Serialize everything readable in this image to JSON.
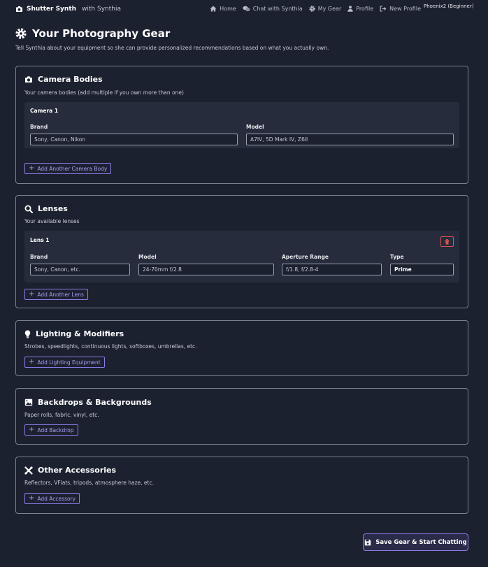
{
  "nav": {
    "brand": "Shutter Synth",
    "brand_sub": "with Synthia",
    "items": [
      {
        "label": "Home",
        "icon": "home-icon"
      },
      {
        "label": "Chat with Synthia",
        "icon": "chat-icon"
      },
      {
        "label": "My Gear",
        "icon": "gear-icon"
      },
      {
        "label": "Profile",
        "icon": "user-icon"
      },
      {
        "label": "New Profile",
        "icon": "sign-out-icon"
      }
    ],
    "user": "Phoenix2 (Beginner)"
  },
  "page": {
    "title": "Your Photography Gear",
    "description": "Tell Synthia about your equipment so she can provide personalized recommendations based on what you actually own."
  },
  "cameras": {
    "title": "Camera Bodies",
    "description": "Your camera bodies (add multiple if you own more than one)",
    "card_title": "Camera 1",
    "brand_label": "Brand",
    "brand_placeholder": "Sony, Canon, Nikon",
    "model_label": "Model",
    "model_placeholder": "A7IV, 5D Mark IV, Z6II",
    "add_label": "Add Another Camera Body"
  },
  "lenses": {
    "title": "Lenses",
    "description": "Your available lenses",
    "card_title": "Lens 1",
    "brand_label": "Brand",
    "brand_placeholder": "Sony, Canon, etc.",
    "model_label": "Model",
    "model_placeholder": "24-70mm f/2.8",
    "aperture_label": "Aperture Range",
    "aperture_placeholder": "f/1.8, f/2.8-4",
    "type_label": "Type",
    "type_value": "Prime",
    "add_label": "Add Another Lens"
  },
  "lighting": {
    "title": "Lighting & Modifiers",
    "description": "Strobes, speedlights, continuous lights, softboxes, umbrellas, etc.",
    "add_label": "Add Lighting Equipment"
  },
  "backdrops": {
    "title": "Backdrops & Backgrounds",
    "description": "Paper rolls, fabric, vinyl, etc.",
    "add_label": "Add Backdrop"
  },
  "accessories": {
    "title": "Other Accessories",
    "description": "Reflectors, VFlats, tripods, atmosphere haze, etc.",
    "add_label": "Add Accessory"
  },
  "save_label": "Save Gear & Start Chatting",
  "colors": {
    "background": "#1c2130",
    "card": "#262c3b",
    "accent": "#8e7ce8",
    "danger": "#d9534f"
  }
}
